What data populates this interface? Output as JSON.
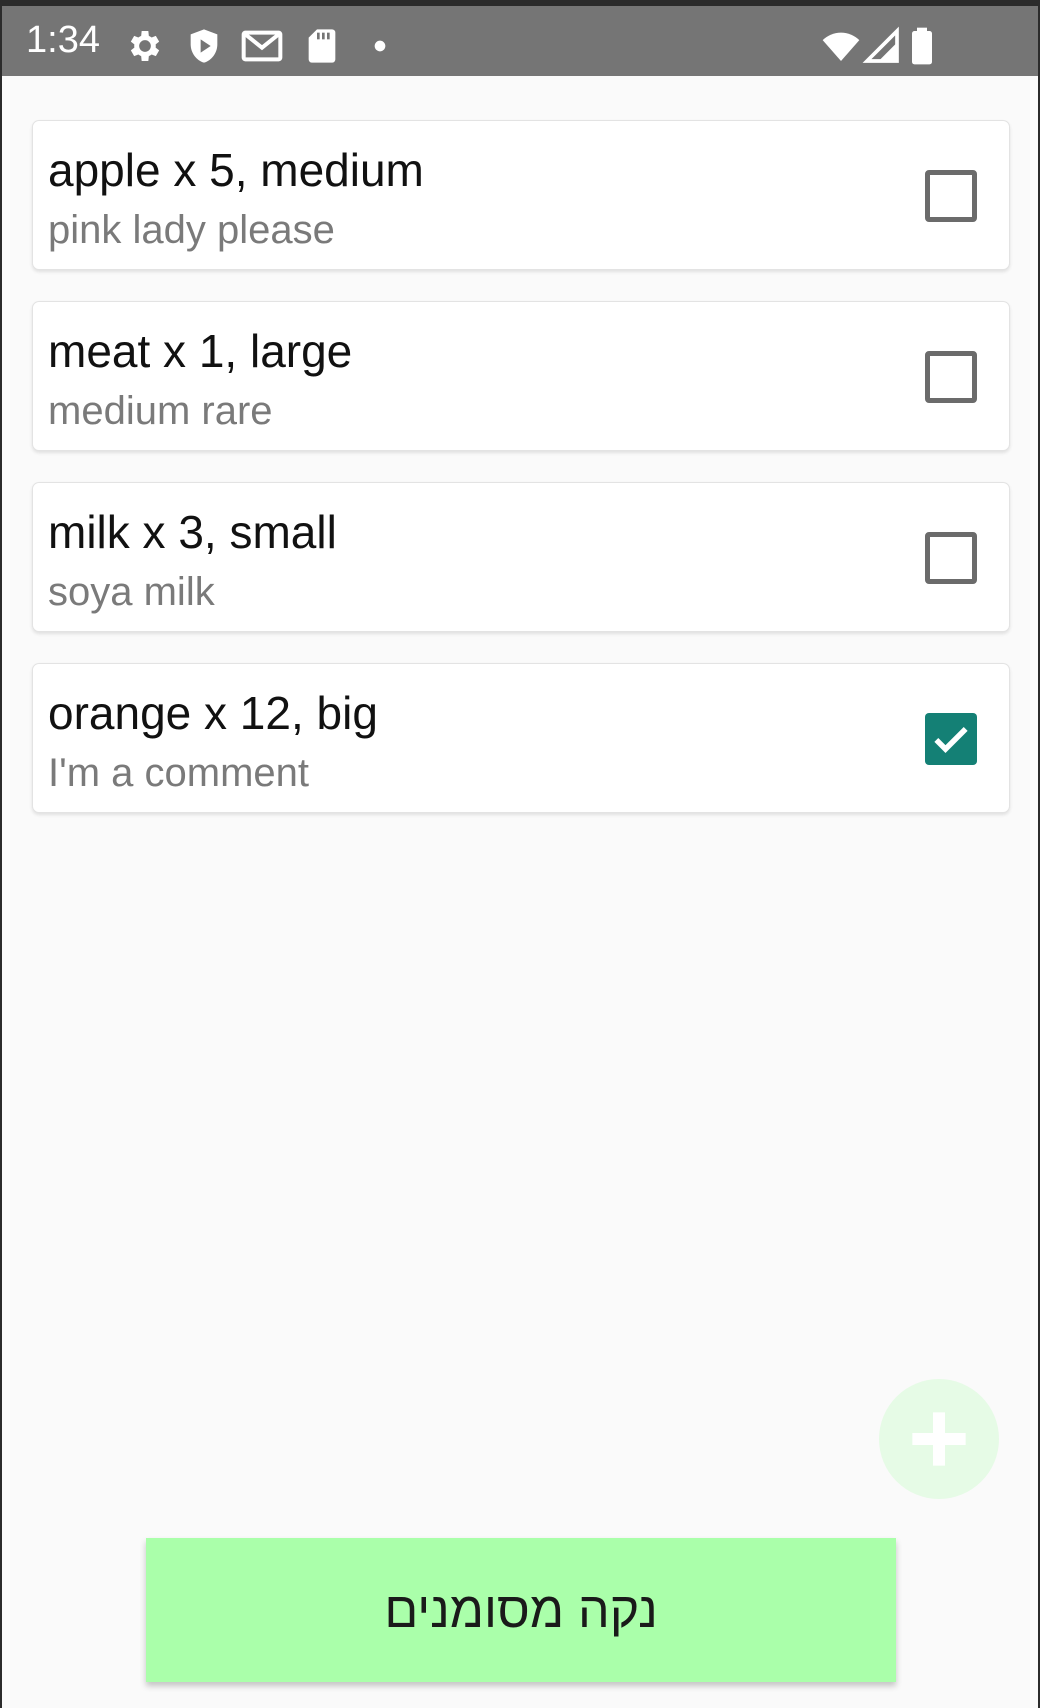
{
  "status_bar": {
    "time": "1:34",
    "icons": [
      "settings-icon",
      "shield-play-icon",
      "gmail-icon",
      "sd-card-icon",
      "notification-dot-icon",
      "wifi-icon",
      "cell-signal-icon",
      "battery-icon"
    ]
  },
  "items": [
    {
      "title": "apple x 5, medium",
      "comment": "pink lady please",
      "checked": false
    },
    {
      "title": "meat x 1, large",
      "comment": "medium rare",
      "checked": false
    },
    {
      "title": "milk x 3, small",
      "comment": "soya milk",
      "checked": false
    },
    {
      "title": "orange x 12, big",
      "comment": "I'm a comment",
      "checked": true
    }
  ],
  "fab": {
    "icon": "plus-icon"
  },
  "clear_button": {
    "label": "נקה מסומנים"
  },
  "colors": {
    "status_bar": "#757575",
    "background": "#fafafa",
    "checked_accent": "#148075",
    "button": "#aaffaa",
    "fab": "#e6fbe6"
  }
}
